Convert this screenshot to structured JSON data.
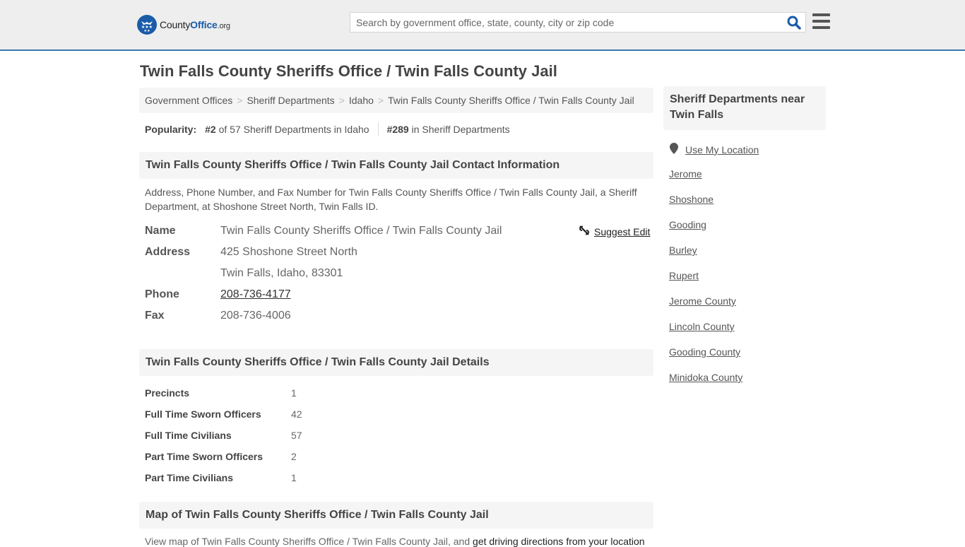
{
  "header": {
    "logo": {
      "name": "County",
      "name_accent": "Office",
      "tld": ".org"
    },
    "search": {
      "placeholder": "Search by government office, state, county, city or zip code",
      "value": ""
    },
    "search_icon": "search-icon",
    "menu_icon": "hamburger-menu-icon"
  },
  "page": {
    "title": "Twin Falls County Sheriffs Office / Twin Falls County Jail",
    "breadcrumb": [
      "Government Offices",
      "Sheriff Departments",
      "Idaho",
      "Twin Falls County Sheriffs Office / Twin Falls County Jail"
    ],
    "breadcrumb_separator": ">",
    "popularity": {
      "label": "Popularity:",
      "state_rank": "#2",
      "state_rank_text": "of 57 Sheriff Departments in Idaho",
      "national_rank": "#289",
      "national_rank_text": "in Sheriff Departments"
    }
  },
  "contact": {
    "header": "Twin Falls County Sheriffs Office / Twin Falls County Jail Contact Information",
    "description": "Address, Phone Number, and Fax Number for Twin Falls County Sheriffs Office / Twin Falls County Jail, a Sheriff Department, at Shoshone Street North, Twin Falls ID.",
    "suggest_edit": "Suggest Edit",
    "rows": {
      "name_label": "Name",
      "name_value": "Twin Falls County Sheriffs Office / Twin Falls County Jail",
      "address_label": "Address",
      "address_line1": "425 Shoshone Street North",
      "address_line2": "Twin Falls, Idaho, 83301",
      "phone_label": "Phone",
      "phone_value": "208-736-4177",
      "fax_label": "Fax",
      "fax_value": "208-736-4006"
    }
  },
  "details": {
    "header": "Twin Falls County Sheriffs Office / Twin Falls County Jail Details",
    "rows": [
      {
        "label": "Precincts",
        "value": "1"
      },
      {
        "label": "Full Time Sworn Officers",
        "value": "42"
      },
      {
        "label": "Full Time Civilians",
        "value": "57"
      },
      {
        "label": "Part Time Sworn Officers",
        "value": "2"
      },
      {
        "label": "Part Time Civilians",
        "value": "1"
      }
    ]
  },
  "map": {
    "header": "Map of Twin Falls County Sheriffs Office / Twin Falls County Jail",
    "description": "View map of Twin Falls County Sheriffs Office / Twin Falls County Jail, and ",
    "directions_link": "get driving directions from your location"
  },
  "sidebar": {
    "title": "Sheriff Departments near Twin Falls",
    "use_location": "Use My Location",
    "links": [
      "Jerome",
      "Shoshone",
      "Gooding",
      "Burley",
      "Rupert",
      "Jerome County",
      "Lincoln County",
      "Gooding County",
      "Minidoka County"
    ]
  },
  "colors": {
    "brand_blue": "#1a5ca8",
    "topbar_border": "#3a79b0",
    "panel_bg": "#f5f5f5"
  }
}
